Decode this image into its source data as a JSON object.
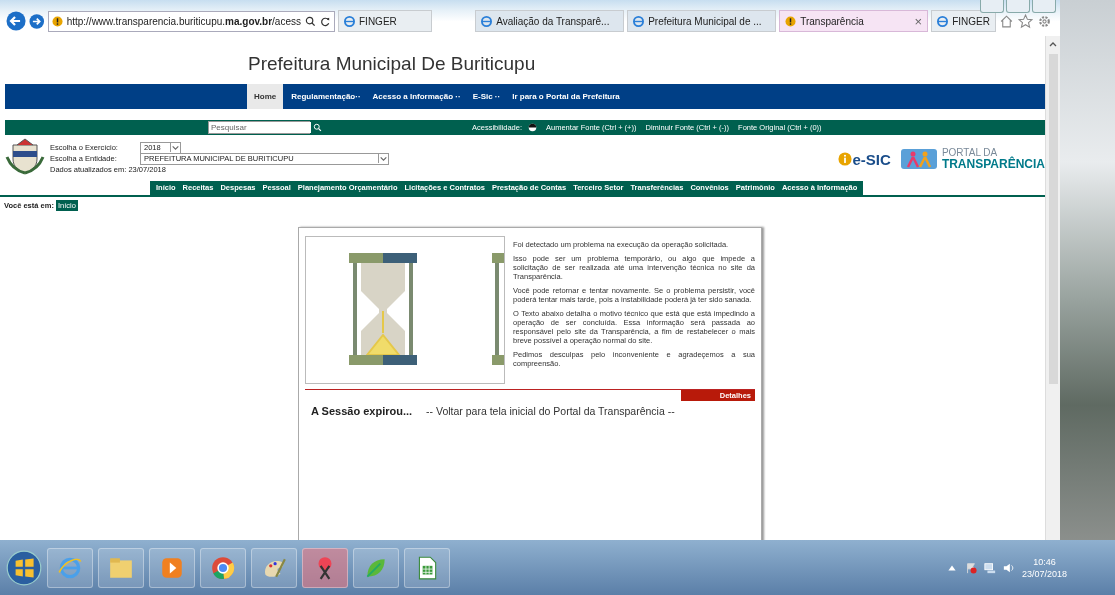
{
  "browser": {
    "address": "http://www.transparencia.buriticupu.**ma.gov.br**/acess",
    "tabs": [
      {
        "label": "FINGER",
        "selected": false
      },
      {
        "label": "Avaliação da Transparê...",
        "selected": false
      },
      {
        "label": "Prefeitura Municipal de ...",
        "selected": false
      },
      {
        "label": "Transparência",
        "selected": true,
        "close": "×"
      },
      {
        "label": "FINGER",
        "selected": false
      }
    ]
  },
  "site": {
    "title": "Prefeitura Municipal De Buriticupu",
    "nav": [
      {
        "label": "Home",
        "selected": true
      },
      {
        "label": "Regulamentação··",
        "selected": false
      },
      {
        "label": "Acesso a Informação ··",
        "selected": false
      },
      {
        "label": "E-Sic ··",
        "selected": false
      },
      {
        "label": "Ir para o Portal da Prefeitura",
        "selected": false
      }
    ],
    "search": {
      "placeholder": "Pesquisar"
    },
    "accessibility": {
      "label": "Acessibilidade:",
      "links": [
        "Aumentar Fonte (Ctrl + (+))",
        "Diminuir Fonte (Ctrl + (-))",
        "Fonte Original (Ctrl + (0))"
      ]
    },
    "filters": [
      {
        "label": "Escolha o Exercício:",
        "value": "2018"
      },
      {
        "label": "Escolha a Entidade:",
        "value": "PREFEITURA MUNICIPAL DE BURITICUPU"
      }
    ],
    "updated": "Dados atualizados em: 23/07/2018",
    "esic": "e-SIC",
    "portal": [
      "PORTAL DA",
      "TRANSPARÊNCIA"
    ],
    "menu": [
      "Início",
      "Receitas",
      "Despesas",
      "Pessoal",
      "Planejamento Orçamentário",
      "Licitações e Contratos",
      "Prestação de Contas",
      "Terceiro Setor",
      "Transferências",
      "Convênios",
      "Patrimônio",
      "Acesso à Informação"
    ],
    "breadcrumb": {
      "label": "Você está em:",
      "current": "Início"
    },
    "error": {
      "paragraphs": [
        "Foi detectado um problema na execução da operação solicitada.",
        "Isso pode ser um problema temporário, ou algo que impede a solicitação de ser realizada até uma intervenção técnica no site da Transparência.",
        "Você pode retornar e tentar novamente. Se o problema persistir, você poderá tentar mais tarde, pois a instabilidade poderá já ter sido sanada.",
        "O Texto abaixo detalha o motivo técnico que está que está impedindo a operação de ser concluída. Essa informação será passada ao responsável pelo site da Transparência, a fim de restabelecer o mais breve possível a operação normal do site.",
        "Pedimos desculpas pelo inconveniente e agradeçemos a sua compreensão."
      ],
      "details": "Detalhes",
      "session": "A Sessão expirou...",
      "back": "-- Voltar para tela inicial do Portal da Transparência --"
    }
  },
  "taskbar": {
    "apps": [
      {
        "kind": "ie",
        "selected": false
      },
      {
        "kind": "folder",
        "selected": false
      },
      {
        "kind": "media",
        "selected": false
      },
      {
        "kind": "chrome",
        "selected": false
      },
      {
        "kind": "paint",
        "selected": false
      },
      {
        "kind": "snip",
        "selected": true
      },
      {
        "kind": "green",
        "selected": false
      },
      {
        "kind": "sheet",
        "selected": false
      }
    ],
    "time": "10:46",
    "date": "23/07/2018"
  }
}
